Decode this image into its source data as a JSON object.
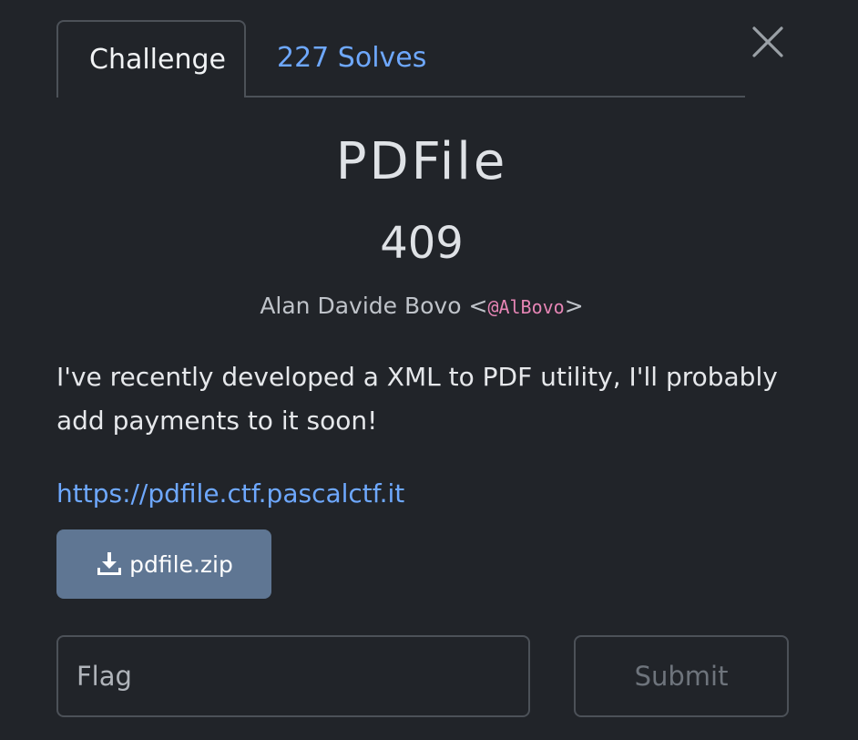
{
  "tabs": {
    "challenge_label": "Challenge",
    "solves_label": "227 Solves"
  },
  "close": {
    "icon": "close-icon"
  },
  "challenge": {
    "name": "PDFile",
    "points": "409",
    "author_name": "Alan Davide Bovo",
    "author_open": "<",
    "author_handle": "@AlBovo",
    "author_close": ">",
    "description": "I've recently developed a XML to PDF utility, I'll probably add payments to it soon!",
    "link": "https://pdfile.ctf.pascalctf.it",
    "file_label": "pdfile.zip",
    "file_icon": "download-icon"
  },
  "flag_form": {
    "placeholder": "Flag",
    "value": "",
    "submit_label": "Submit"
  },
  "colors": {
    "background": "#212429",
    "link": "#6ea8fe",
    "button": "#5f7693",
    "handle": "#e685b5",
    "border": "#4c5158"
  }
}
